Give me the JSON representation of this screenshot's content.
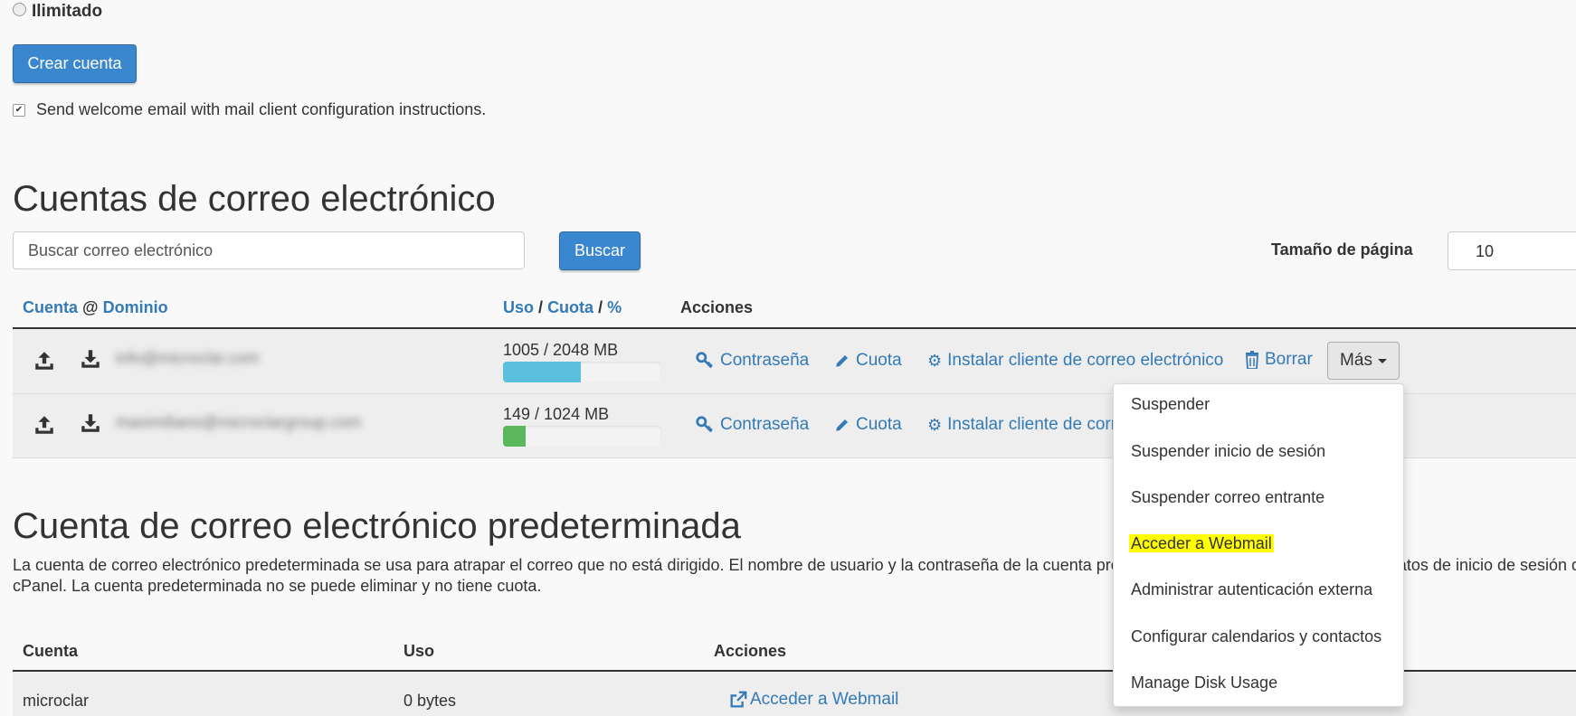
{
  "form": {
    "unlimited_label": "Ilimitado",
    "create_button": "Crear cuenta",
    "welcome_checkbox_label": "Send welcome email with mail client configuration instructions."
  },
  "accounts": {
    "title": "Cuentas de correo electrónico",
    "search_placeholder": "Buscar correo electrónico",
    "search_button": "Buscar",
    "page_size_label": "Tamaño de página",
    "page_size_value": "10",
    "headers": {
      "account": "Cuenta",
      "at": "@",
      "domain": "Dominio",
      "usage": "Uso",
      "slash": "/",
      "quota": "Cuota",
      "percent": "%",
      "actions": "Acciones"
    },
    "rows": [
      {
        "email": "info@microclar.com",
        "usage": "1005 / 2048 MB",
        "usage_fraction": 0.49,
        "bar_color": "#5bc0de"
      },
      {
        "email": "maximiliano@microclargroup.com",
        "usage": "149 / 1024 MB",
        "usage_fraction": 0.145,
        "bar_color": "#5cb85c"
      }
    ],
    "actions": {
      "password": "Contraseña",
      "quota": "Cuota",
      "install_client": "Instalar cliente de correo electrónico",
      "install_client_truncated": "Instalar cliente de corre",
      "delete": "Borrar",
      "more": "Más"
    }
  },
  "dropdown": {
    "items": [
      "Suspender",
      "Suspender inicio de sesión",
      "Suspender correo entrante",
      "Acceder a Webmail",
      "Administrar autenticación externa",
      "Configurar calendarios y contactos",
      "Manage Disk Usage"
    ],
    "highlight_color": "#ffff00"
  },
  "default_account": {
    "title": "Cuenta de correo electrónico predeterminada",
    "description_line1": "La cuenta de correo electrónico predeterminada se usa para atrapar el correo que no está dirigido. El nombre de usuario y la contraseña de la cuenta predeterminada son los mismos que los datos de inicio de sesión de la cuenta de",
    "description_line2": "cPanel. La cuenta predeterminada no se puede eliminar y no tiene cuota.",
    "headers": {
      "account": "Cuenta",
      "usage": "Uso",
      "actions": "Acciones"
    },
    "row": {
      "account": "microclar",
      "usage": "0 bytes",
      "action": "Acceder a Webmail"
    }
  },
  "colors": {
    "link": "#337ab7",
    "primary": "#3a87d0",
    "background": "#f9f9f9"
  }
}
